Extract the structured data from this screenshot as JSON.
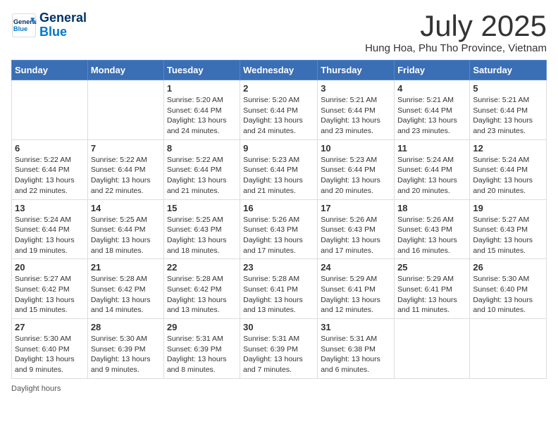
{
  "logo": {
    "line1": "General",
    "line2": "Blue"
  },
  "title": {
    "month_year": "July 2025",
    "location": "Hung Hoa, Phu Tho Province, Vietnam"
  },
  "weekdays": [
    "Sunday",
    "Monday",
    "Tuesday",
    "Wednesday",
    "Thursday",
    "Friday",
    "Saturday"
  ],
  "weeks": [
    [
      {
        "day": "",
        "info": ""
      },
      {
        "day": "",
        "info": ""
      },
      {
        "day": "1",
        "info": "Sunrise: 5:20 AM\nSunset: 6:44 PM\nDaylight: 13 hours and 24 minutes."
      },
      {
        "day": "2",
        "info": "Sunrise: 5:20 AM\nSunset: 6:44 PM\nDaylight: 13 hours and 24 minutes."
      },
      {
        "day": "3",
        "info": "Sunrise: 5:21 AM\nSunset: 6:44 PM\nDaylight: 13 hours and 23 minutes."
      },
      {
        "day": "4",
        "info": "Sunrise: 5:21 AM\nSunset: 6:44 PM\nDaylight: 13 hours and 23 minutes."
      },
      {
        "day": "5",
        "info": "Sunrise: 5:21 AM\nSunset: 6:44 PM\nDaylight: 13 hours and 23 minutes."
      }
    ],
    [
      {
        "day": "6",
        "info": "Sunrise: 5:22 AM\nSunset: 6:44 PM\nDaylight: 13 hours and 22 minutes."
      },
      {
        "day": "7",
        "info": "Sunrise: 5:22 AM\nSunset: 6:44 PM\nDaylight: 13 hours and 22 minutes."
      },
      {
        "day": "8",
        "info": "Sunrise: 5:22 AM\nSunset: 6:44 PM\nDaylight: 13 hours and 21 minutes."
      },
      {
        "day": "9",
        "info": "Sunrise: 5:23 AM\nSunset: 6:44 PM\nDaylight: 13 hours and 21 minutes."
      },
      {
        "day": "10",
        "info": "Sunrise: 5:23 AM\nSunset: 6:44 PM\nDaylight: 13 hours and 20 minutes."
      },
      {
        "day": "11",
        "info": "Sunrise: 5:24 AM\nSunset: 6:44 PM\nDaylight: 13 hours and 20 minutes."
      },
      {
        "day": "12",
        "info": "Sunrise: 5:24 AM\nSunset: 6:44 PM\nDaylight: 13 hours and 20 minutes."
      }
    ],
    [
      {
        "day": "13",
        "info": "Sunrise: 5:24 AM\nSunset: 6:44 PM\nDaylight: 13 hours and 19 minutes."
      },
      {
        "day": "14",
        "info": "Sunrise: 5:25 AM\nSunset: 6:44 PM\nDaylight: 13 hours and 18 minutes."
      },
      {
        "day": "15",
        "info": "Sunrise: 5:25 AM\nSunset: 6:43 PM\nDaylight: 13 hours and 18 minutes."
      },
      {
        "day": "16",
        "info": "Sunrise: 5:26 AM\nSunset: 6:43 PM\nDaylight: 13 hours and 17 minutes."
      },
      {
        "day": "17",
        "info": "Sunrise: 5:26 AM\nSunset: 6:43 PM\nDaylight: 13 hours and 17 minutes."
      },
      {
        "day": "18",
        "info": "Sunrise: 5:26 AM\nSunset: 6:43 PM\nDaylight: 13 hours and 16 minutes."
      },
      {
        "day": "19",
        "info": "Sunrise: 5:27 AM\nSunset: 6:43 PM\nDaylight: 13 hours and 15 minutes."
      }
    ],
    [
      {
        "day": "20",
        "info": "Sunrise: 5:27 AM\nSunset: 6:42 PM\nDaylight: 13 hours and 15 minutes."
      },
      {
        "day": "21",
        "info": "Sunrise: 5:28 AM\nSunset: 6:42 PM\nDaylight: 13 hours and 14 minutes."
      },
      {
        "day": "22",
        "info": "Sunrise: 5:28 AM\nSunset: 6:42 PM\nDaylight: 13 hours and 13 minutes."
      },
      {
        "day": "23",
        "info": "Sunrise: 5:28 AM\nSunset: 6:41 PM\nDaylight: 13 hours and 13 minutes."
      },
      {
        "day": "24",
        "info": "Sunrise: 5:29 AM\nSunset: 6:41 PM\nDaylight: 13 hours and 12 minutes."
      },
      {
        "day": "25",
        "info": "Sunrise: 5:29 AM\nSunset: 6:41 PM\nDaylight: 13 hours and 11 minutes."
      },
      {
        "day": "26",
        "info": "Sunrise: 5:30 AM\nSunset: 6:40 PM\nDaylight: 13 hours and 10 minutes."
      }
    ],
    [
      {
        "day": "27",
        "info": "Sunrise: 5:30 AM\nSunset: 6:40 PM\nDaylight: 13 hours and 9 minutes."
      },
      {
        "day": "28",
        "info": "Sunrise: 5:30 AM\nSunset: 6:39 PM\nDaylight: 13 hours and 9 minutes."
      },
      {
        "day": "29",
        "info": "Sunrise: 5:31 AM\nSunset: 6:39 PM\nDaylight: 13 hours and 8 minutes."
      },
      {
        "day": "30",
        "info": "Sunrise: 5:31 AM\nSunset: 6:39 PM\nDaylight: 13 hours and 7 minutes."
      },
      {
        "day": "31",
        "info": "Sunrise: 5:31 AM\nSunset: 6:38 PM\nDaylight: 13 hours and 6 minutes."
      },
      {
        "day": "",
        "info": ""
      },
      {
        "day": "",
        "info": ""
      }
    ]
  ],
  "footer": {
    "daylight_hours": "Daylight hours"
  }
}
